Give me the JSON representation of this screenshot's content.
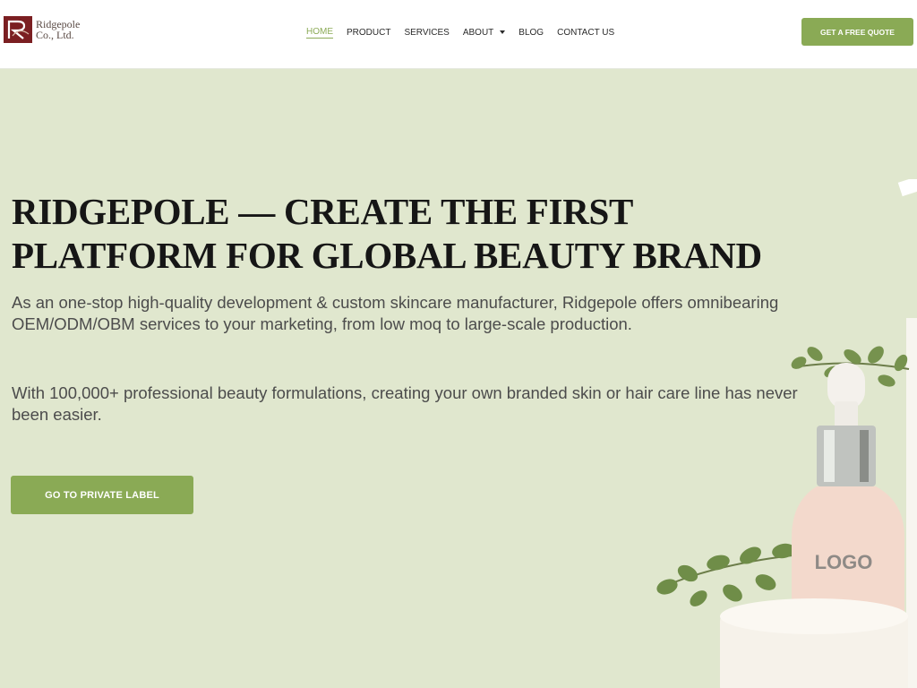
{
  "brand": {
    "name_line1": "Ridgepole",
    "name_line2": "Co., Ltd."
  },
  "nav": {
    "items": [
      {
        "label": "HOME",
        "active": true
      },
      {
        "label": "PRODUCT"
      },
      {
        "label": "SERVICES"
      },
      {
        "label": "ABOUT",
        "has_dropdown": true
      },
      {
        "label": "BLOG"
      },
      {
        "label": "CONTACT US"
      }
    ],
    "quote_button": "GET A FREE QUOTE"
  },
  "hero": {
    "title_line1": "RIDGEPOLE — CREATE THE FIRST",
    "title_line2": "PLATFORM FOR GLOBAL BEAUTY BRAND",
    "paragraph1": "As an one-stop high-quality development & custom skincare manufacturer, Ridgepole offers omnibearing OEM/ODM/OBM services to your marketing, from low moq to large-scale production.",
    "paragraph2": "With 100,000+ professional beauty formulations, creating your own branded skin or hair care line has never been easier.",
    "cta_button": "GO TO PRIVATE LABEL",
    "bottle_label": "LOGO"
  },
  "colors": {
    "accent": "#8aaa55",
    "hero_background": "#e0e7ce",
    "header_background": "#ffffff",
    "logo_mark": "#7b1f22"
  }
}
